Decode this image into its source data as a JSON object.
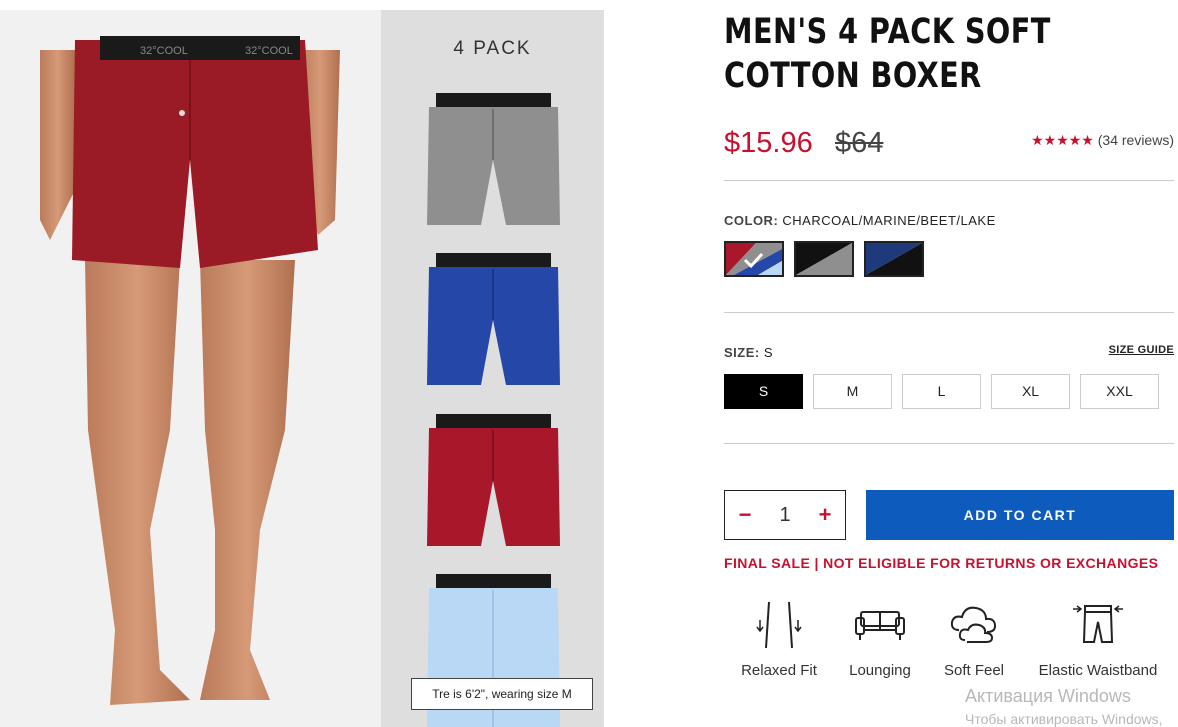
{
  "product": {
    "title": "MEN'S 4 PACK SOFT COTTON BOXER",
    "sale_price": "$15.96",
    "original_price": "$64",
    "rating_stars": "★★★★★",
    "reviews": "(34 reviews)"
  },
  "gallery": {
    "pack_label": "4 PACK",
    "caption": "Tre is 6'2\", wearing size M",
    "waistband_text": "32°COOL",
    "pack_colors": [
      "#8f8f8f",
      "#2447a8",
      "#a8172a",
      "#b9d8f5"
    ],
    "model_boxer_color": "#9a1a26"
  },
  "color": {
    "label": "COLOR:",
    "value": "CHARCOAL/MARINE/BEET/LAKE",
    "swatches": [
      {
        "name": "charcoal-marine-beet-lake",
        "selected": true
      },
      {
        "name": "black-gray",
        "selected": false
      },
      {
        "name": "navy-black",
        "selected": false
      }
    ]
  },
  "size": {
    "label": "SIZE:",
    "value": "S",
    "guide_label": "SIZE GUIDE",
    "options": [
      "S",
      "M",
      "L",
      "XL",
      "XXL"
    ],
    "selected": "S"
  },
  "cart": {
    "quantity": "1",
    "minus": "−",
    "plus": "+",
    "add_label": "ADD TO CART",
    "final_sale": "FINAL SALE | NOT ELIGIBLE FOR RETURNS OR EXCHANGES"
  },
  "features": [
    {
      "label": "Relaxed Fit",
      "icon": "relaxed-fit-icon"
    },
    {
      "label": "Lounging",
      "icon": "sofa-icon"
    },
    {
      "label": "Soft Feel",
      "icon": "cloud-icon"
    },
    {
      "label": "Elastic Waistband",
      "icon": "waistband-icon"
    }
  ],
  "watermark": {
    "line1": "Активация Windows",
    "line2": "Чтобы активировать Windows,"
  },
  "colors": {
    "accent_red": "#c8102e",
    "button_blue": "#0d5bbd"
  }
}
